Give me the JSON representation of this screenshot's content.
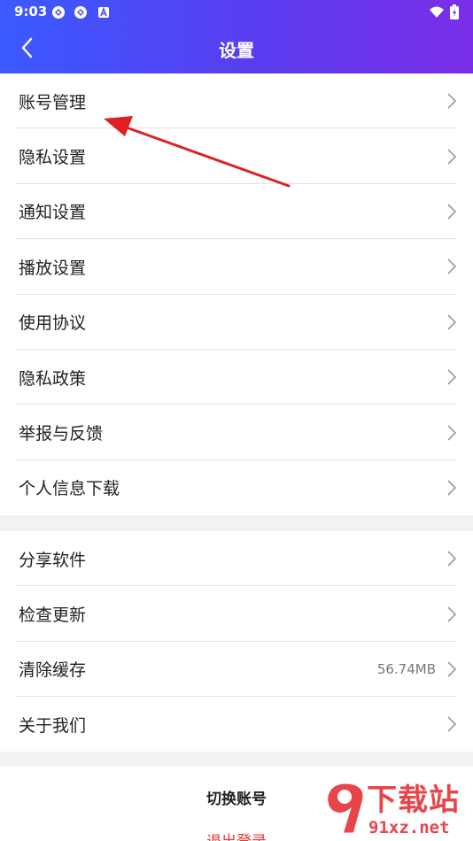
{
  "status_bar": {
    "time": "9:03",
    "icons": [
      "app-notification-icon",
      "app-notification-icon",
      "a-badge-icon",
      "wifi-icon",
      "battery-charging-icon"
    ]
  },
  "header": {
    "title": "设置",
    "back_icon": "chevron-left-icon",
    "gradient": [
      "#3b5bff",
      "#7b2ee8"
    ]
  },
  "group1": [
    {
      "label": "账号管理"
    },
    {
      "label": "隐私设置"
    },
    {
      "label": "通知设置"
    },
    {
      "label": "播放设置"
    },
    {
      "label": "使用协议"
    },
    {
      "label": "隐私政策"
    },
    {
      "label": "举报与反馈"
    },
    {
      "label": "个人信息下载"
    }
  ],
  "group2": [
    {
      "label": "分享软件",
      "value": ""
    },
    {
      "label": "检查更新",
      "value": ""
    },
    {
      "label": "清除缓存",
      "value": "56.74MB"
    },
    {
      "label": "关于我们",
      "value": ""
    }
  ],
  "footer": {
    "switch_account": "切换账号",
    "logout": "退出登录",
    "logout_color": "#e53935"
  },
  "annotation": {
    "arrow_color": "#e02020"
  },
  "watermark": {
    "name": "下载站",
    "url": "91xz.net",
    "color": "#e8454a"
  }
}
